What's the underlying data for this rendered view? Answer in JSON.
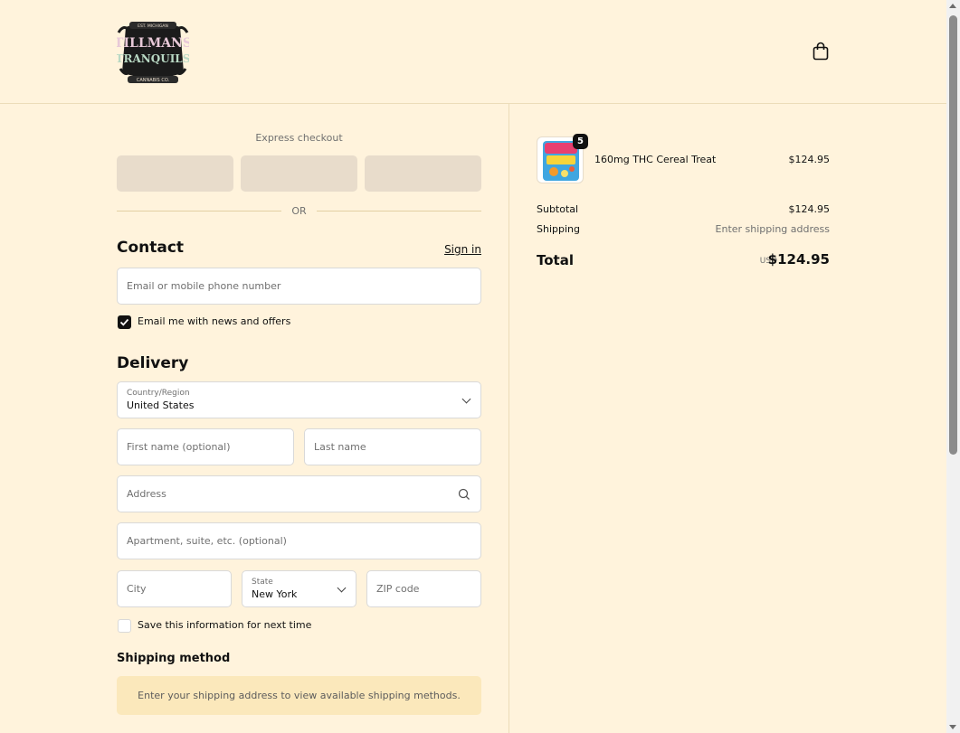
{
  "header": {
    "logo": {
      "icon": "tillmans-tranquils-logo",
      "top_text": "EST. MICHIGAN",
      "line1": "TILLMANS",
      "line2": "TRANQUILS",
      "bottom_text": "CANNABIS CO."
    },
    "cart_icon": "shopping-bag-icon"
  },
  "express": {
    "label": "Express checkout",
    "buttons": [
      "",
      "",
      ""
    ],
    "or_label": "OR"
  },
  "contact": {
    "title": "Contact",
    "sign_in": "Sign in",
    "email_placeholder": "Email or mobile phone number",
    "news_label": "Email me with news and offers",
    "news_checked": true
  },
  "delivery": {
    "title": "Delivery",
    "country_label": "Country/Region",
    "country_value": "United States",
    "first_name_placeholder": "First name (optional)",
    "last_name_placeholder": "Last name",
    "address_placeholder": "Address",
    "apartment_placeholder": "Apartment, suite, etc. (optional)",
    "city_placeholder": "City",
    "state_label": "State",
    "state_value": "New York",
    "zip_placeholder": "ZIP code",
    "save_label": "Save this information for next time",
    "save_checked": false
  },
  "shipping": {
    "title": "Shipping method",
    "notice": "Enter your shipping address to view available shipping methods."
  },
  "summary": {
    "product": {
      "name": "160mg THC Cereal Treat",
      "price": "$124.95",
      "quantity": "5"
    },
    "subtotal_label": "Subtotal",
    "subtotal_value": "$124.95",
    "shipping_label": "Shipping",
    "shipping_value": "Enter shipping address",
    "total_label": "Total",
    "total_currency": "USD",
    "total_value": "$124.95"
  },
  "colors": {
    "background": "#fff3dc",
    "notice_bg": "#fbe8bb",
    "express_btn": "#e8dccb",
    "divider": "#ecdcb9"
  }
}
